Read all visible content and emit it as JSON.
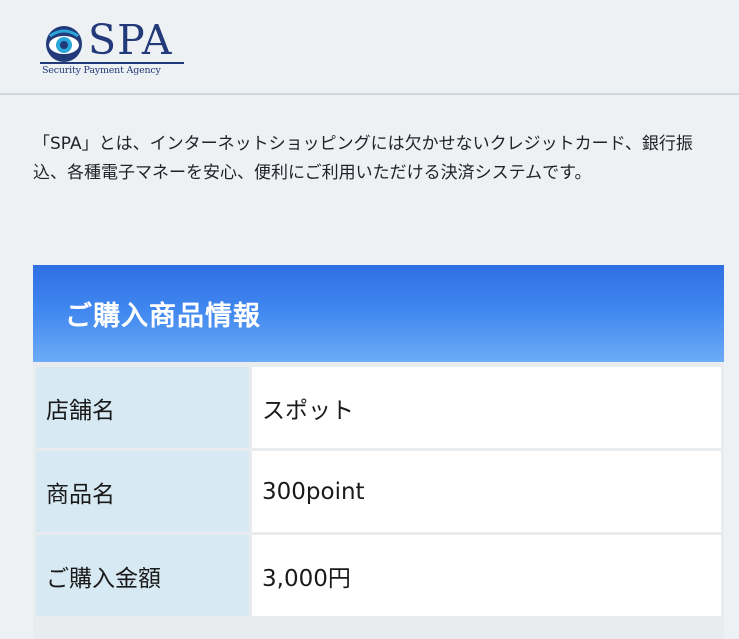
{
  "logo": {
    "name": "SPA",
    "tagline": "Security Payment Agency"
  },
  "description": "「SPA」とは、インターネットショッピングには欠かせないクレジットカード、銀行振込、各種電子マネーを安心、便利にご利用いただける決済システムです。",
  "purchase_info": {
    "title": "ご購入商品情報",
    "rows": [
      {
        "label": "店舗名",
        "value": "スポット"
      },
      {
        "label": "商品名",
        "value": "300point"
      },
      {
        "label": "ご購入金額",
        "value": "3,000円"
      }
    ]
  },
  "colors": {
    "brand": "#233a7a",
    "header_gradient_top": "#2f6fe3",
    "header_gradient_bottom": "#6cabf7",
    "label_cell_bg": "#d7e9f2"
  }
}
